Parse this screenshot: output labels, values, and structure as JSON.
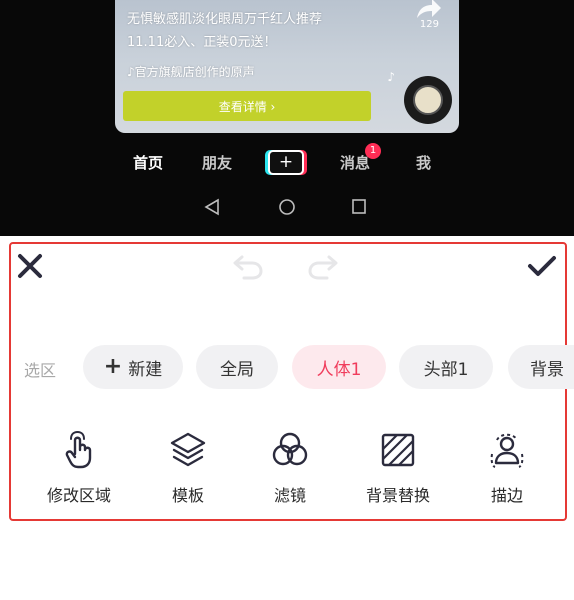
{
  "video_card": {
    "line1": "无惧敏感肌淡化眼周万千红人推荐",
    "line2": "11.11必入、正装0元送！",
    "source": "♪官方旗舰店创作的原声",
    "cta": "查看详情 ›",
    "share_count": "129",
    "cta_color": "#c2d12a"
  },
  "bottom_nav": {
    "home": "首页",
    "friends": "朋友",
    "plus": "+",
    "messages": "消息",
    "messages_badge": "1",
    "me": "我"
  },
  "editor": {
    "selection_label": "选区",
    "chips": {
      "new": "新建",
      "global": "全局",
      "body": "人体1",
      "head": "头部1",
      "background": "背景"
    },
    "tools": {
      "modify_area": "修改区域",
      "template": "模板",
      "filter": "滤镜",
      "background_replace": "背景替换",
      "outline": "描边"
    },
    "accent_color": "#f03c5c",
    "highlight_color": "#e53935"
  }
}
